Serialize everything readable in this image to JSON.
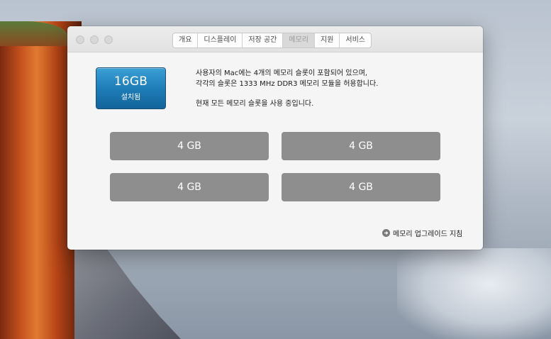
{
  "tabs": [
    {
      "label": "개요",
      "active": false
    },
    {
      "label": "디스플레이",
      "active": false
    },
    {
      "label": "저장 공간",
      "active": false
    },
    {
      "label": "메모리",
      "active": true
    },
    {
      "label": "지원",
      "active": false
    },
    {
      "label": "서비스",
      "active": false
    }
  ],
  "badge": {
    "size": "16GB",
    "label": "설치됨"
  },
  "description": {
    "line1": "사용자의 Mac에는 4개의 메모리 슬롯이 포함되어 있으며,",
    "line2": "각각의 슬롯은 1333 MHz DDR3 메모리 모듈을 허용합니다.",
    "line3": "현재 모든 메모리 슬롯을 사용 중입니다."
  },
  "slots": [
    "4 GB",
    "4 GB",
    "4 GB",
    "4 GB"
  ],
  "upgrade_link": {
    "label": "메모리 업그레이드 지침",
    "icon": "arrow-circle-icon"
  },
  "colors": {
    "badge": "#1f7db8",
    "slot": "#8e8e8e"
  }
}
